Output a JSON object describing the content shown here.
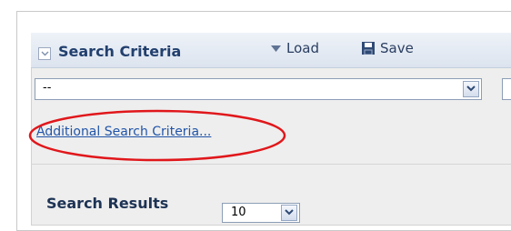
{
  "criteria_panel": {
    "title": "Search Criteria",
    "collapse_icon": "chevron-down-icon",
    "load_label": "Load",
    "load_icon": "triangle-down-icon",
    "save_label": "Save",
    "save_icon": "floppy-disk-icon"
  },
  "saved_search_select": {
    "value": "--",
    "arrow_icon": "chevron-down-icon"
  },
  "additional_criteria_link": {
    "label": "Additional Search Criteria..."
  },
  "annotation": {
    "color": "#e0171b"
  },
  "results_panel": {
    "title": "Search Results",
    "page_size_value": "10",
    "arrow_icon": "chevron-down-icon"
  },
  "colors": {
    "header_text": "#22406e",
    "link": "#2155a8",
    "panel_bg": "#eeeeee"
  }
}
